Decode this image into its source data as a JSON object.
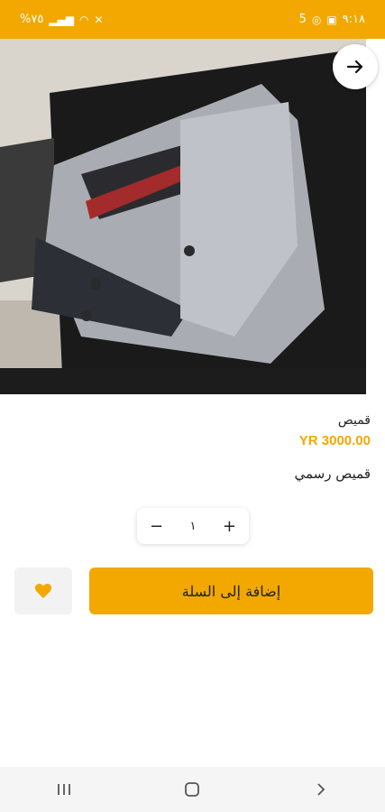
{
  "status_bar": {
    "left_text": "%٧٥",
    "right_time": "٩:١٨",
    "right_num": "5",
    "icons_left": [
      "battery-icon",
      "signal-icon",
      "wifi-icon",
      "mute-icon"
    ],
    "icons_right": [
      "whatsapp-icon",
      "gallery-icon"
    ]
  },
  "product": {
    "title": "قميص",
    "price": "YR 3000.00",
    "description": "قميص رسمي"
  },
  "quantity": {
    "value": "١",
    "minus": "−",
    "plus": "+"
  },
  "actions": {
    "add_to_cart": "إضافة إلى السلة"
  },
  "colors": {
    "accent": "#f2a800"
  }
}
